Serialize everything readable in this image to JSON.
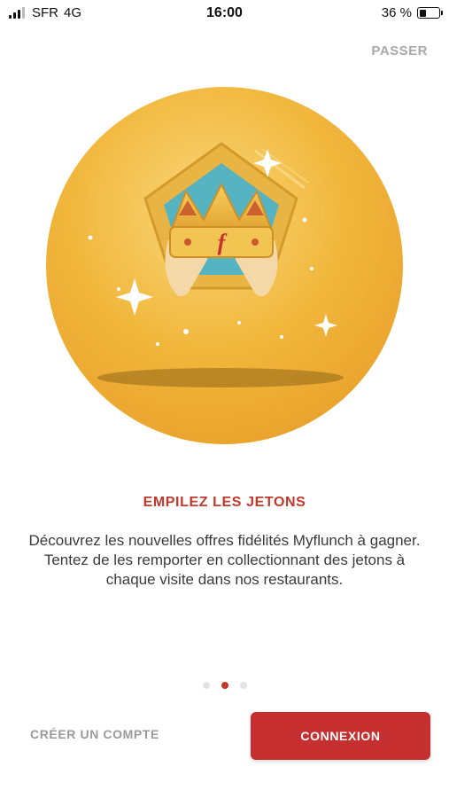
{
  "status_bar": {
    "carrier": "SFR",
    "network": "4G",
    "time": "16:00",
    "battery_text": "36 %",
    "battery_level": 0.36
  },
  "skip_label": "PASSER",
  "hero": {
    "illustration": "crown-token-illustration",
    "crown_letter": "f"
  },
  "onboarding": {
    "title": "EMPILEZ LES JETONS",
    "description": "Découvrez les nouvelles offres fidélités Myflunch à gagner. Tentez de les remporter en collectionnant des jetons à chaque visite dans nos restaurants.",
    "page_count": 3,
    "active_page": 2
  },
  "buttons": {
    "create_account": "CRÉER UN COMPTE",
    "login": "CONNEXION"
  },
  "colors": {
    "accent": "#c62f2f",
    "title": "#c0392b",
    "gold": "#f1b73c",
    "teal": "#4fb3c2"
  }
}
